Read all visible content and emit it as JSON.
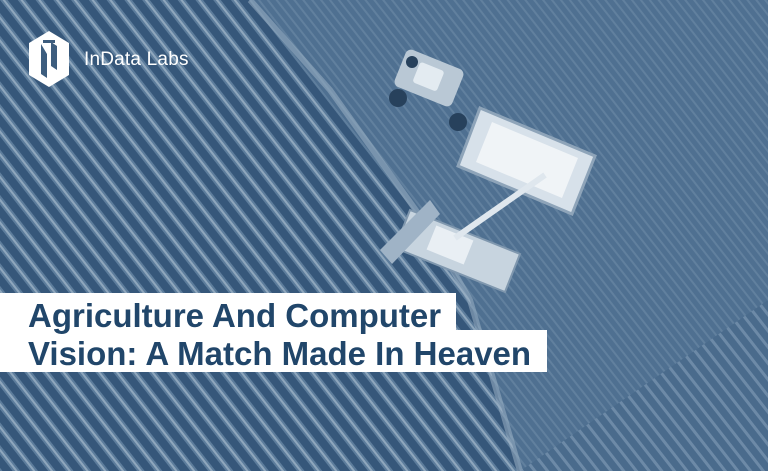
{
  "brand": {
    "name": "InData Labs",
    "logo_icon": "indata-labs-hexagon-icon"
  },
  "headline": {
    "line1": "Agriculture And Computer",
    "line2": "Vision: A Match Made In Heaven"
  },
  "background": {
    "subject": "aerial-harvest-field-photo"
  },
  "colors": {
    "tint": "#3d5d7e",
    "headline_text": "#21466a",
    "headline_bg": "#ffffff",
    "brand_text": "#ffffff"
  }
}
